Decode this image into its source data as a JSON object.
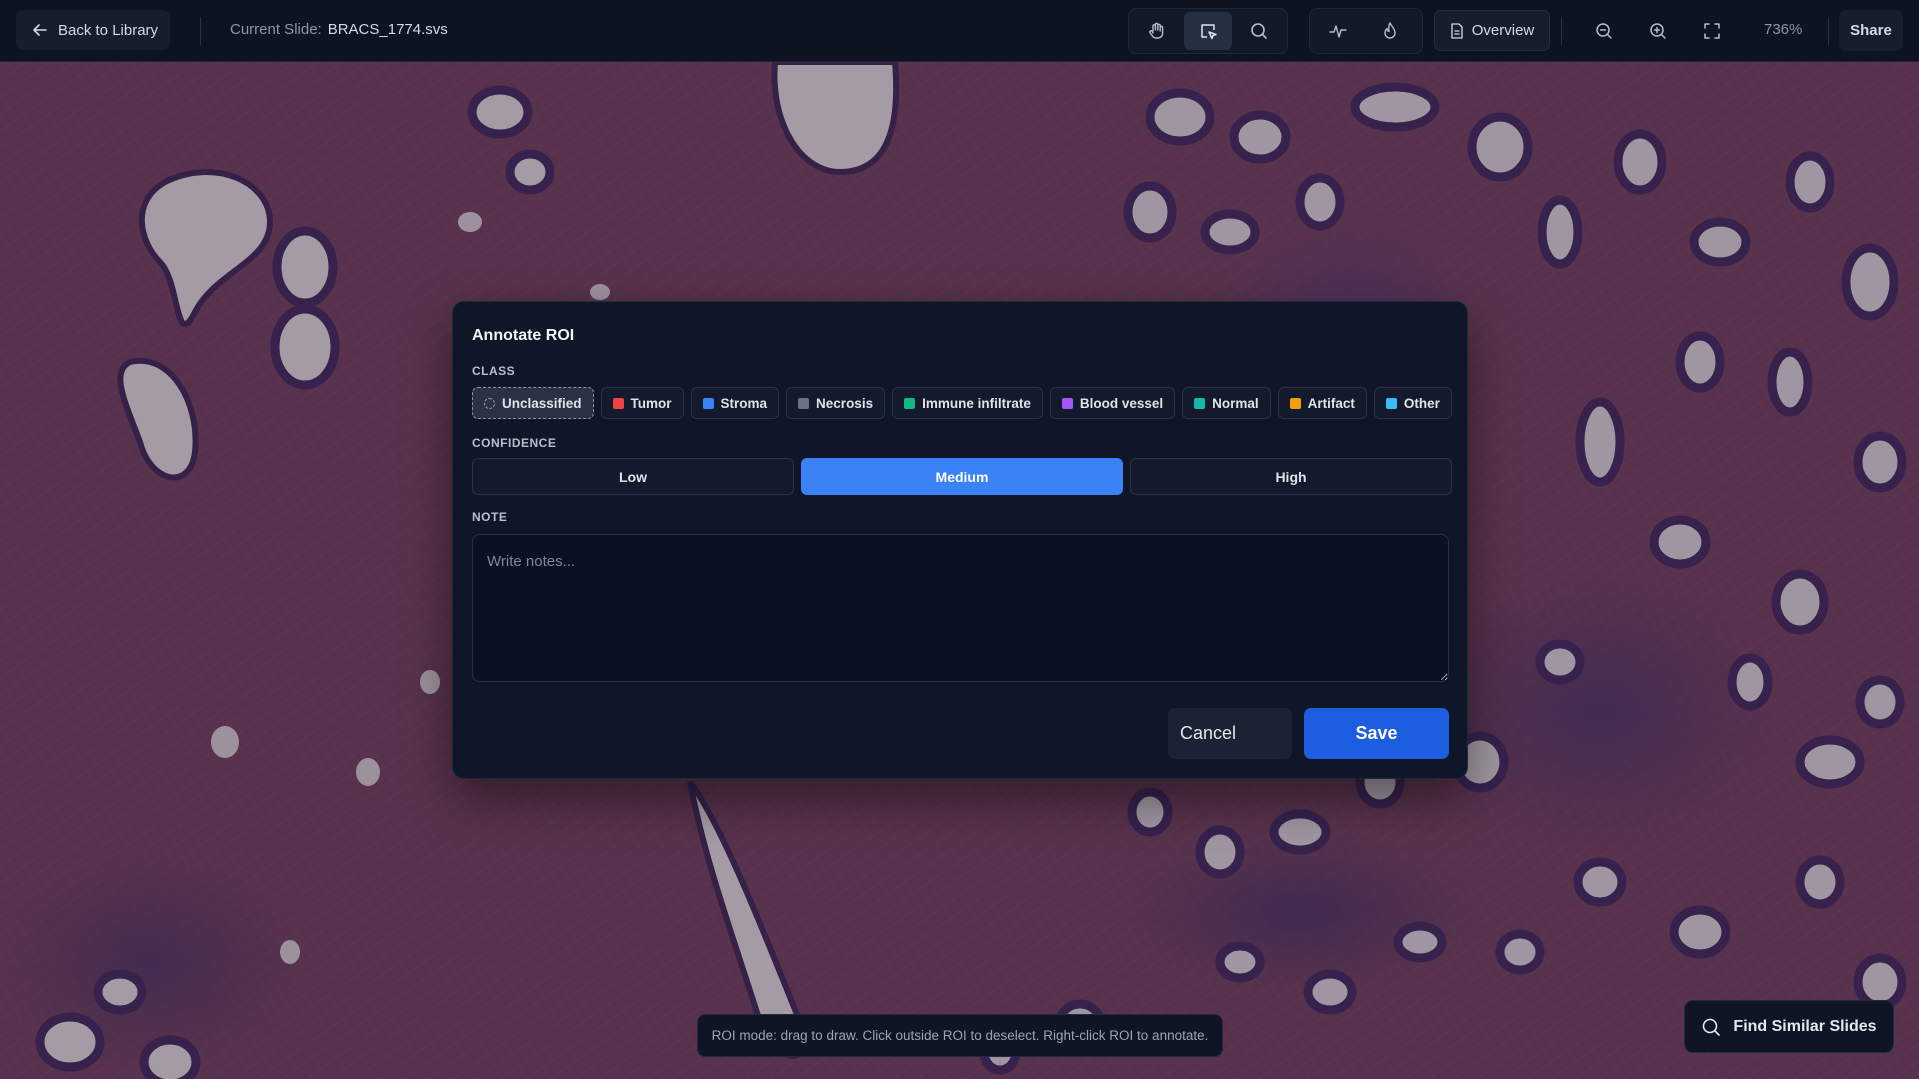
{
  "topbar": {
    "back_label": "Back to Library",
    "current_slide_label": "Current Slide:",
    "current_slide_name": "BRACS_1774.svs",
    "tools": [
      "hand-icon",
      "select-roi-icon",
      "search-icon",
      "pulse-icon",
      "flame-icon"
    ],
    "overview_label": "Overview",
    "zoom_level": "736%",
    "share_label": "Share"
  },
  "modal": {
    "title": "Annotate ROI",
    "class_label": "CLASS",
    "classes": [
      {
        "label": "Unclassified",
        "color": "none",
        "selected": true
      },
      {
        "label": "Tumor",
        "color": "#ef4444"
      },
      {
        "label": "Stroma",
        "color": "#3b82f6"
      },
      {
        "label": "Necrosis",
        "color": "#6b7280"
      },
      {
        "label": "Immune infiltrate",
        "color": "#10b981"
      },
      {
        "label": "Blood vessel",
        "color": "#a855f7"
      },
      {
        "label": "Normal",
        "color": "#14b8a6"
      },
      {
        "label": "Artifact",
        "color": "#f59e0b"
      },
      {
        "label": "Other",
        "color": "#38bdf8"
      }
    ],
    "confidence_label": "CONFIDENCE",
    "confidence": {
      "low": "Low",
      "medium": "Medium",
      "high": "High",
      "selected": "Medium"
    },
    "note_label": "NOTE",
    "note_placeholder": "Write notes...",
    "cancel_label": "Cancel",
    "save_label": "Save"
  },
  "footer": {
    "hint": "ROI mode: drag to draw. Click outside ROI to deselect. Right-click ROI to annotate.",
    "find_similar_label": "Find Similar Slides"
  },
  "colors": {
    "accent": "#3b82f6",
    "save": "#1d5de0",
    "background": "#0d1321"
  }
}
